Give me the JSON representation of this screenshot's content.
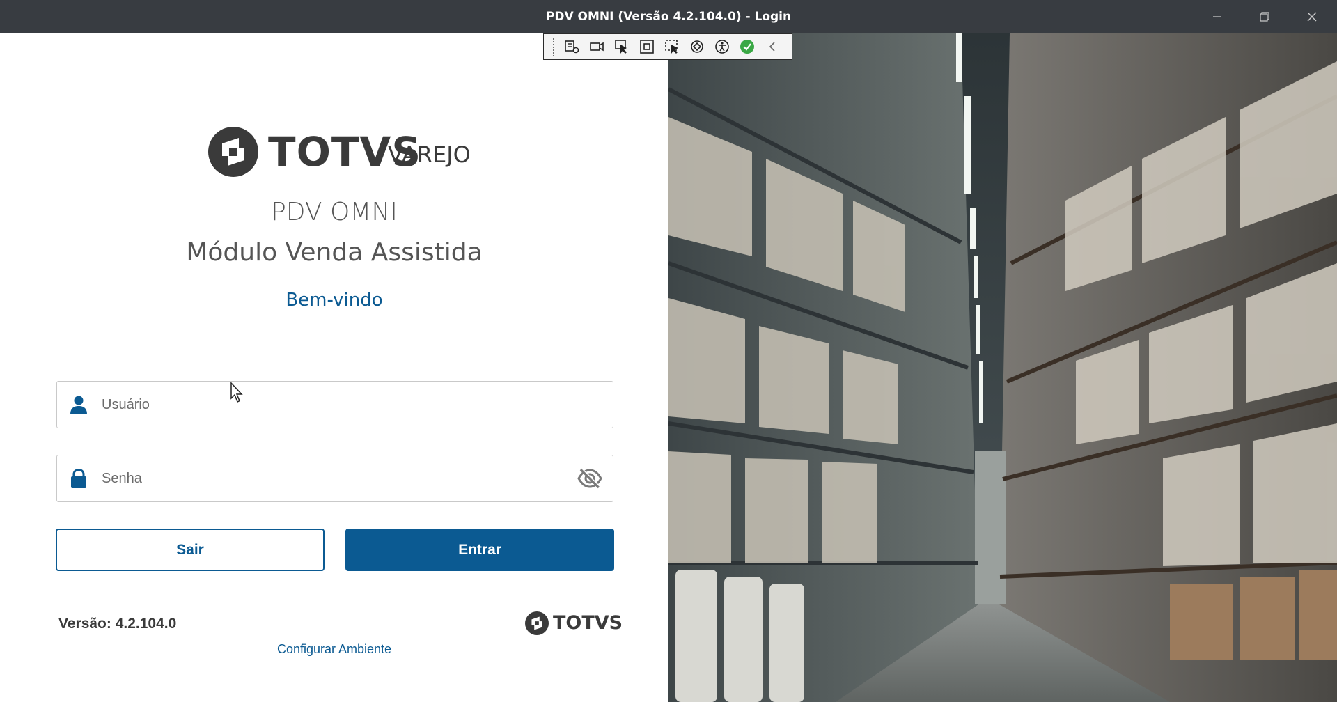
{
  "window": {
    "title": "PDV OMNI (Versão 4.2.104.0) - Login"
  },
  "brand": {
    "logo_word": "TOTVS",
    "logo_sub": "VAREJO",
    "footer_logo_word": "TOTVS"
  },
  "login": {
    "app_name": "PDV OMNI",
    "module_name": "Módulo Venda Assistida",
    "welcome": "Bem-vindo",
    "user_placeholder": "Usuário",
    "user_value": "",
    "password_placeholder": "Senha",
    "password_value": "",
    "exit_label": "Sair",
    "enter_label": "Entrar",
    "version_text": "Versão: 4.2.104.0",
    "config_link": "Configurar Ambiente"
  },
  "toolbar": {
    "icons": [
      "live-visual-tree-icon",
      "record-icon",
      "select-element-icon",
      "display-layout-adorners-icon",
      "track-focus-icon",
      "hot-reload-icon",
      "accessibility-icon",
      "binding-ok-icon",
      "collapse-icon"
    ]
  },
  "colors": {
    "titlebar": "#383c41",
    "accent": "#0b5a92",
    "text_dark": "#3a3a3a",
    "text_muted": "#555555"
  }
}
